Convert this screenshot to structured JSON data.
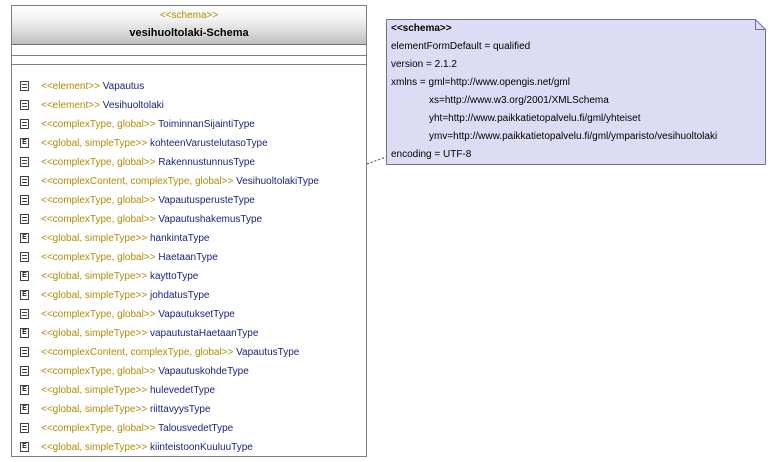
{
  "class": {
    "stereotype": "<<schema>>",
    "name": "vesihuoltolaki-Schema",
    "members": [
      {
        "stereotype": "<<element>>",
        "name": "Vapautus",
        "icon": "type-icon"
      },
      {
        "stereotype": "<<element>>",
        "name": "Vesihuoltolaki",
        "icon": "type-icon"
      },
      {
        "stereotype": "<<complexType, global>>",
        "name": "ToiminnanSijaintiType",
        "icon": "type-icon"
      },
      {
        "stereotype": "<<global, simpleType>>",
        "name": "kohteenVarustelutasoType",
        "icon": "enum-icon"
      },
      {
        "stereotype": "<<complexType, global>>",
        "name": "RakennustunnusType",
        "icon": "type-icon"
      },
      {
        "stereotype": "<<complexContent, complexType, global>>",
        "name": "VesihuoltolakiType",
        "icon": "type-icon"
      },
      {
        "stereotype": "<<complexType, global>>",
        "name": "VapautusperusteType",
        "icon": "type-icon"
      },
      {
        "stereotype": "<<complexType, global>>",
        "name": "VapautushakemusType",
        "icon": "type-icon"
      },
      {
        "stereotype": "<<global, simpleType>>",
        "name": "hankintaType",
        "icon": "enum-icon"
      },
      {
        "stereotype": "<<complexType, global>>",
        "name": "HaetaanType",
        "icon": "type-icon"
      },
      {
        "stereotype": "<<global, simpleType>>",
        "name": "kayttoType",
        "icon": "enum-icon"
      },
      {
        "stereotype": "<<global, simpleType>>",
        "name": "johdatusType",
        "icon": "enum-icon"
      },
      {
        "stereotype": "<<complexType, global>>",
        "name": "VapautuksetType",
        "icon": "type-icon"
      },
      {
        "stereotype": "<<global, simpleType>>",
        "name": "vapautustaHaetaanType",
        "icon": "enum-icon"
      },
      {
        "stereotype": "<<complexContent, complexType, global>>",
        "name": "VapautusType",
        "icon": "type-icon"
      },
      {
        "stereotype": "<<complexType, global>>",
        "name": "VapautuskohdeType",
        "icon": "type-icon"
      },
      {
        "stereotype": "<<global, simpleType>>",
        "name": "hulevedetType",
        "icon": "enum-icon"
      },
      {
        "stereotype": "<<global, simpleType>>",
        "name": "riittavyysType",
        "icon": "enum-icon"
      },
      {
        "stereotype": "<<complexType, global>>",
        "name": "TalousvedetType",
        "icon": "type-icon"
      },
      {
        "stereotype": "<<global, simpleType>>",
        "name": "kiinteistoonKuuluuType",
        "icon": "enum-icon"
      }
    ]
  },
  "note": {
    "title": "<<schema>>",
    "lines": [
      "elementFormDefault = qualified",
      "version = 2.1.2",
      "xmlns = gml=http://www.opengis.net/gml",
      "xs=http://www.w3.org/2001/XMLSchema",
      "yht=http://www.paikkatietopalvelu.fi/gml/yhteiset",
      "ymv=http://www.paikkatietopalvelu.fi/gml/ymparisto/vesihuoltolaki",
      "encoding = UTF-8"
    ]
  },
  "colors": {
    "stereotype": "#b08c00",
    "member_name": "#1a237e",
    "note_fill": "#dcdcf4",
    "note_border": "#6f6f9a"
  }
}
